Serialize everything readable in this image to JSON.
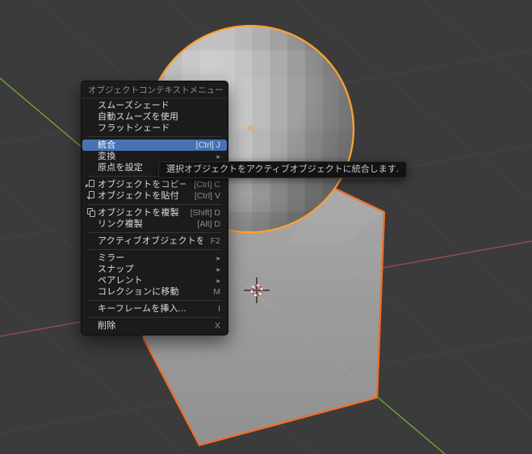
{
  "app": {
    "name": "Blender 3D Viewport"
  },
  "colors": {
    "viewport_background": "#3b3b3b",
    "grid_line": "#474747",
    "axis_x_red": "#a8494f",
    "axis_y_green": "#77a83d",
    "menu_background": "#1b1b1b",
    "menu_highlight_accent": "#4772b3",
    "selected_outline_orange": "#ee6e2b",
    "active_outline_orange": "#ffa132"
  },
  "context_menu": {
    "title": "オブジェクトコンテキストメニュー",
    "sections": [
      {
        "items": [
          {
            "id": "shade-smooth",
            "label": "スムーズシェード"
          },
          {
            "id": "use-auto-smooth",
            "label": "自動スムーズを使用"
          },
          {
            "id": "shade-flat",
            "label": "フラットシェード"
          }
        ]
      },
      {
        "items": [
          {
            "id": "join",
            "label": "統合",
            "shortcut": "[Ctrl] J",
            "highlighted": true
          },
          {
            "id": "convert",
            "label": "変換",
            "submenu": true
          },
          {
            "id": "set-origin",
            "label": "原点を設定",
            "submenu": true
          }
        ]
      },
      {
        "items": [
          {
            "id": "copy-objects",
            "label": "オブジェクトをコピー",
            "shortcut": "[Ctrl] C",
            "icon": "copy-icon"
          },
          {
            "id": "paste-objects",
            "label": "オブジェクトを貼付",
            "shortcut": "[Ctrl] V",
            "icon": "paste-icon"
          }
        ]
      },
      {
        "items": [
          {
            "id": "duplicate-objects",
            "label": "オブジェクトを複製",
            "shortcut": "[Shift] D",
            "icon": "duplicate-icon"
          },
          {
            "id": "duplicate-linked",
            "label": "リンク複製",
            "shortcut": "[Alt] D"
          }
        ]
      },
      {
        "items": [
          {
            "id": "rename-active-object",
            "label": "アクティブオブジェクトをリネーム...",
            "shortcut": "F2"
          }
        ]
      },
      {
        "items": [
          {
            "id": "mirror",
            "label": "ミラー",
            "submenu": true
          },
          {
            "id": "snap",
            "label": "スナップ",
            "submenu": true
          },
          {
            "id": "parent",
            "label": "ペアレント",
            "submenu": true
          },
          {
            "id": "move-to-collection",
            "label": "コレクションに移動",
            "shortcut": "M"
          }
        ]
      },
      {
        "items": [
          {
            "id": "insert-keyframe",
            "label": "キーフレームを挿入...",
            "shortcut": "I"
          }
        ]
      },
      {
        "items": [
          {
            "id": "delete",
            "label": "削除",
            "shortcut": "X"
          }
        ]
      }
    ]
  },
  "tooltip": {
    "text": "選択オブジェクトをアクティブオブジェクトに統合します."
  },
  "icons": {
    "submenu_arrow": "▸"
  },
  "scene": {
    "objects": [
      {
        "id": "cube",
        "type": "mesh-cube",
        "state": "selected"
      },
      {
        "id": "sphere",
        "type": "mesh-uv-sphere",
        "state": "active"
      }
    ],
    "overlays": [
      "3d-cursor",
      "sphere-origin-dot",
      "grid-floor",
      "x-axis",
      "y-axis"
    ]
  }
}
